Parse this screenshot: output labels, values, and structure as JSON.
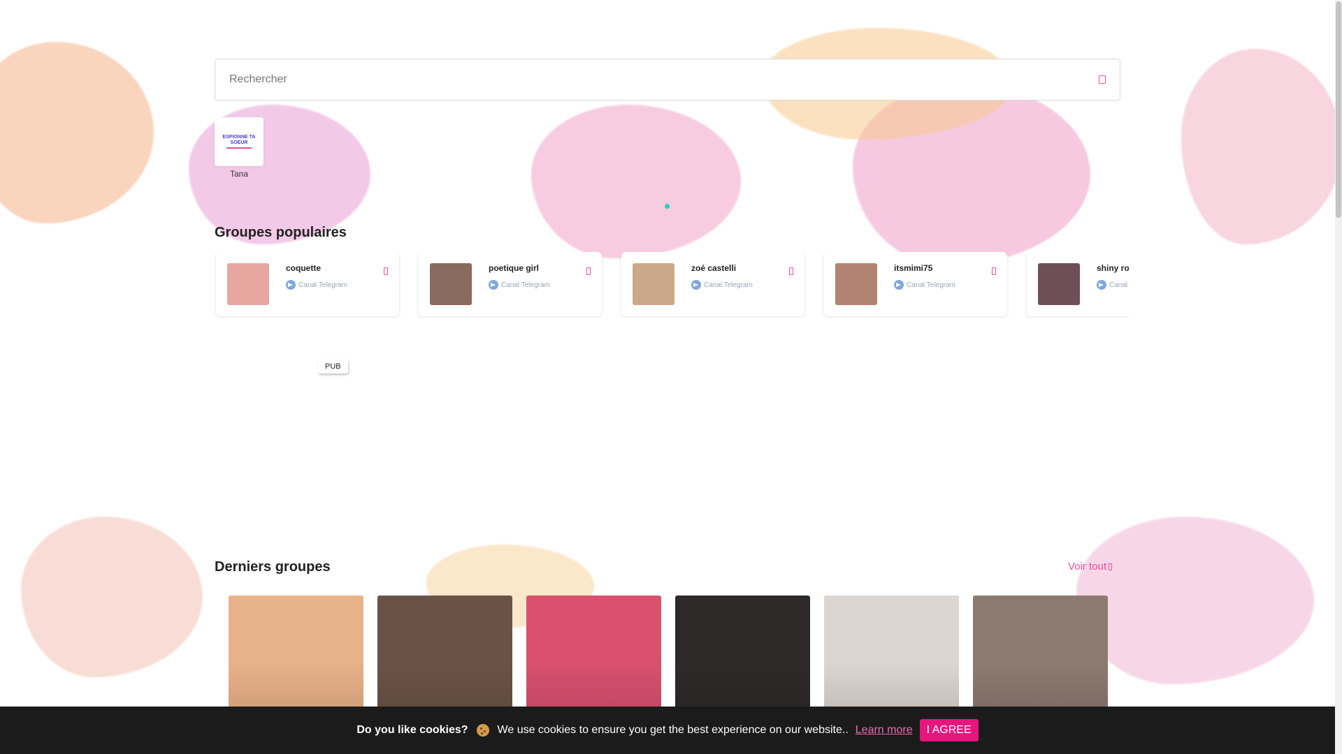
{
  "search": {
    "placeholder": "Rechercher"
  },
  "stories": [
    {
      "label": "Tana",
      "logo_text": "ESPIONNE TA SOEUR"
    }
  ],
  "popular": {
    "title": "Groupes populaires",
    "groups": [
      {
        "name": "coquette",
        "type": "Canal Telegram",
        "color": "#e7a7a0"
      },
      {
        "name": "poetique girl",
        "type": "Canal Telegram",
        "color": "#8a6a5c"
      },
      {
        "name": "zoé castelli",
        "type": "Canal Telegram",
        "color": "#c9a98a"
      },
      {
        "name": "itsmimi75",
        "type": "Canal Telegram",
        "color": "#b08470"
      },
      {
        "name": "shiny ro",
        "type": "Canal Telegram",
        "color": "#6e4f58"
      }
    ]
  },
  "ad": {
    "label": "PUB"
  },
  "latest": {
    "title": "Derniers groupes",
    "see_all": "Voir tout",
    "tiles": [
      {
        "color": "#e8b28a"
      },
      {
        "color": "#6b5246"
      },
      {
        "color": "#d9516f"
      },
      {
        "color": "#2f2a2a"
      },
      {
        "color": "#dcd6d2"
      },
      {
        "color": "#8d7a70"
      }
    ]
  },
  "cookie": {
    "question": "Do you like cookies?",
    "message": "We use cookies to ensure you get the best experience on our website..",
    "learn_more": "Learn more",
    "agree": "I AGREE"
  },
  "colors": {
    "accent": "#e64ca0",
    "teal_dot": "#26d0c2",
    "cookie_bg": "#1b1b1b"
  }
}
